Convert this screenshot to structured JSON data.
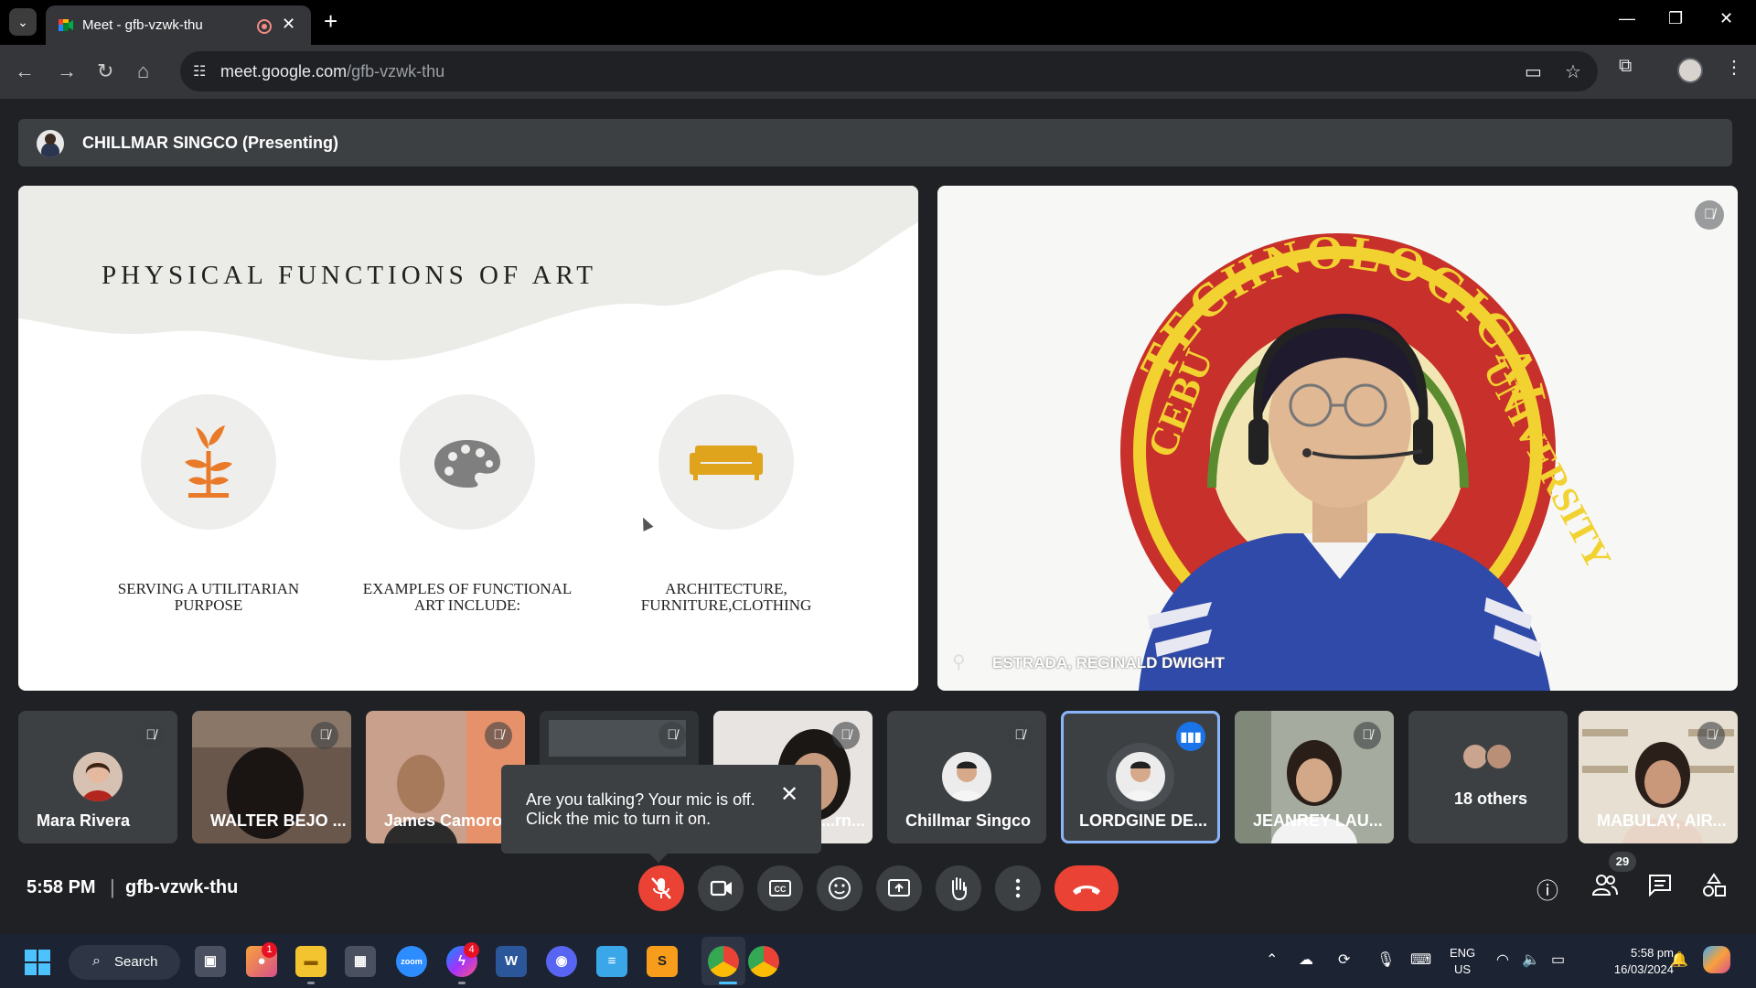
{
  "browser": {
    "tab_title": "Meet - gfb-vzwk-thu",
    "tab_close": "✕",
    "new_tab": "+",
    "url_host": "meet.google.com",
    "url_path": "/gfb-vzwk-thu"
  },
  "presenting": {
    "label": "CHILLMAR SINGCO (Presenting)"
  },
  "slide": {
    "title": "PHYSICAL FUNCTIONS OF ART",
    "items": [
      {
        "icon": "plant-icon",
        "caption": "SERVING A UTILITARIAN PURPOSE"
      },
      {
        "icon": "palette-icon",
        "caption": "EXAMPLES OF FUNCTIONAL ART INCLUDE:"
      },
      {
        "icon": "sofa-icon",
        "caption": "ARCHITECTURE, FURNITURE,CLOTHING"
      }
    ]
  },
  "main_video": {
    "name": "ESTRADA, REGINALD DWIGHT",
    "seal_top_text": "TECHNOLOGICAL",
    "seal_left_text": "CEBU",
    "seal_right_text": "UNIVERSITY"
  },
  "participants": [
    {
      "name": "Mara Rivera",
      "muted": true
    },
    {
      "name": "WALTER BEJO ...",
      "muted": true
    },
    {
      "name": "James Camoro",
      "muted": true
    },
    {
      "name": "",
      "muted": true
    },
    {
      "name": "...rn...",
      "muted": true
    },
    {
      "name": "Chillmar Singco",
      "muted": true
    },
    {
      "name": "LORDGINE DE...",
      "muted": false,
      "speaking": true
    },
    {
      "name": "JEANREY LAU...",
      "muted": true
    },
    {
      "name": "18 others",
      "muted": false
    },
    {
      "name": "MABULAY, AIR...",
      "muted": true
    }
  ],
  "toast": {
    "line1": "Are you talking? Your mic is off.",
    "line2": "Click the mic to turn it on.",
    "close": "✕"
  },
  "meeting": {
    "time": "5:58 PM",
    "separator": "|",
    "code": "gfb-vzwk-thu",
    "participant_count": "29"
  },
  "taskbar": {
    "search_label": "Search",
    "zoom_label": "zoom",
    "badge_teams": "1",
    "badge_messenger": "4",
    "lang_line1": "ENG",
    "lang_line2": "US",
    "clock_time": "5:58 pm",
    "clock_date": "16/03/2024"
  },
  "colors": {
    "meet_bg": "#202124",
    "tile_bg": "#3c4043",
    "danger": "#ea4335",
    "accent_blue": "#1a73e8",
    "slide_orange": "#e87a2a",
    "slide_gold": "#e0a31c"
  }
}
